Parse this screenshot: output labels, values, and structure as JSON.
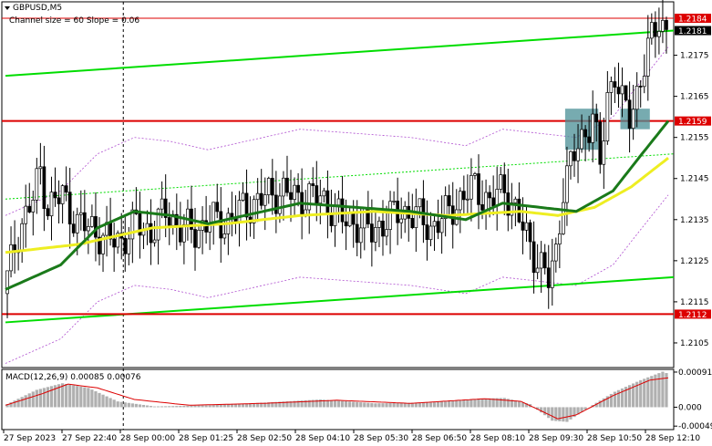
{
  "window": {
    "symbol_title": "GBPUSD,M5",
    "channel_info": "Channel size = 60 Slope = 0.06",
    "menu_arrow": "triangle-down"
  },
  "colors": {
    "background": "#ffffff",
    "frame": "#000000",
    "bull_candle": "#ffffff",
    "bear_candle": "#000000",
    "channel_line": "#00dd00",
    "channel_mid": "#00dd00",
    "ma_fast": "#1a7a1a",
    "ma_slow": "#eeee22",
    "envelope": "#b050d0",
    "level": "#dd0000",
    "highlight_box": "#4a8f96",
    "macd_hist": "#b0b0b0",
    "macd_signal": "#dd0000",
    "price_tag": "#dd0000",
    "current_tag": "#000000"
  },
  "chart_data": {
    "type": "candlestick",
    "symbol": "GBPUSD",
    "timeframe": "M5",
    "y_axis": {
      "ticks": [
        "1.2175",
        "1.2165",
        "1.2155",
        "1.2145",
        "1.2135",
        "1.2125",
        "1.2115",
        "1.2105"
      ],
      "ylim": [
        1.2099,
        1.2188
      ]
    },
    "x_axis": {
      "ticks": [
        "27 Sep 2023",
        "27 Sep 22:40",
        "28 Sep 00:00",
        "28 Sep 01:25",
        "28 Sep 02:50",
        "28 Sep 04:10",
        "28 Sep 05:30",
        "28 Sep 06:50",
        "28 Sep 08:10",
        "28 Sep 09:30",
        "28 Sep 10:50",
        "28 Sep 12:10"
      ],
      "bars": 180
    },
    "price_tags": [
      {
        "label": "1.2184",
        "value": 1.2184,
        "style": "level"
      },
      {
        "label": "1.2181",
        "value": 1.2181,
        "style": "current"
      },
      {
        "label": "1.2159",
        "value": 1.2159,
        "style": "level"
      },
      {
        "label": "1.2112",
        "value": 1.2112,
        "style": "level"
      }
    ],
    "horizontal_levels": [
      1.2184,
      1.2159,
      1.2112
    ],
    "vertical_marker_bar": 32,
    "channel": {
      "upper": [
        [
          0,
          1.217
        ],
        [
          180,
          1.2181
        ]
      ],
      "lower": [
        [
          0,
          1.211
        ],
        [
          180,
          1.2121
        ]
      ],
      "middle": [
        [
          0,
          1.214
        ],
        [
          180,
          1.2151
        ]
      ]
    },
    "highlight_boxes": [
      {
        "from_bar": 152,
        "to_bar": 161,
        "top": 1.2162,
        "bottom": 1.2152
      },
      {
        "from_bar": 167,
        "to_bar": 175,
        "top": 1.2162,
        "bottom": 1.2157
      }
    ],
    "price_path": [
      [
        0,
        1.2117
      ],
      [
        4,
        1.2132
      ],
      [
        8,
        1.214
      ],
      [
        10,
        1.2147
      ],
      [
        12,
        1.2138
      ],
      [
        16,
        1.2141
      ],
      [
        20,
        1.2134
      ],
      [
        24,
        1.2133
      ],
      [
        28,
        1.213
      ],
      [
        32,
        1.213
      ],
      [
        36,
        1.2134
      ],
      [
        40,
        1.2132
      ],
      [
        44,
        1.2137
      ],
      [
        48,
        1.2133
      ],
      [
        52,
        1.2132
      ],
      [
        56,
        1.2135
      ],
      [
        60,
        1.2134
      ],
      [
        64,
        1.2137
      ],
      [
        68,
        1.2139
      ],
      [
        72,
        1.2141
      ],
      [
        76,
        1.2142
      ],
      [
        80,
        1.214
      ],
      [
        84,
        1.2141
      ],
      [
        88,
        1.2139
      ],
      [
        92,
        1.2135
      ],
      [
        96,
        1.2134
      ],
      [
        100,
        1.2132
      ],
      [
        104,
        1.2135
      ],
      [
        108,
        1.2137
      ],
      [
        112,
        1.2136
      ],
      [
        116,
        1.2133
      ],
      [
        120,
        1.2136
      ],
      [
        124,
        1.214
      ],
      [
        128,
        1.2143
      ],
      [
        132,
        1.2139
      ],
      [
        136,
        1.2143
      ],
      [
        140,
        1.2135
      ],
      [
        144,
        1.2127
      ],
      [
        148,
        1.212
      ],
      [
        150,
        1.2127
      ],
      [
        152,
        1.2143
      ],
      [
        156,
        1.2153
      ],
      [
        160,
        1.216
      ],
      [
        162,
        1.2148
      ],
      [
        164,
        1.2165
      ],
      [
        166,
        1.2171
      ],
      [
        168,
        1.2163
      ],
      [
        170,
        1.216
      ],
      [
        172,
        1.2166
      ],
      [
        175,
        1.2176
      ],
      [
        178,
        1.2184
      ],
      [
        180,
        1.2181
      ]
    ],
    "ma_slow": [
      [
        0,
        1.2127
      ],
      [
        20,
        1.2129
      ],
      [
        40,
        1.2133
      ],
      [
        60,
        1.2134
      ],
      [
        80,
        1.2136
      ],
      [
        100,
        1.2137
      ],
      [
        120,
        1.2136
      ],
      [
        140,
        1.2137
      ],
      [
        150,
        1.2136
      ],
      [
        160,
        1.2138
      ],
      [
        170,
        1.2143
      ],
      [
        180,
        1.215
      ]
    ],
    "ma_fast": [
      [
        0,
        1.2118
      ],
      [
        15,
        1.2124
      ],
      [
        25,
        1.2133
      ],
      [
        35,
        1.2137
      ],
      [
        45,
        1.2136
      ],
      [
        55,
        1.2134
      ],
      [
        65,
        1.2136
      ],
      [
        80,
        1.2139
      ],
      [
        95,
        1.2138
      ],
      [
        110,
        1.2137
      ],
      [
        125,
        1.2135
      ],
      [
        135,
        1.2139
      ],
      [
        145,
        1.2138
      ],
      [
        155,
        1.2137
      ],
      [
        165,
        1.2142
      ],
      [
        172,
        1.215
      ],
      [
        180,
        1.2159
      ]
    ],
    "macd": {
      "label": "MACD(12,26,9) 0.00085 0.00076",
      "ticks": [
        "0.00091",
        "0.000",
        "-0.00049"
      ],
      "ylim": [
        -0.00058,
        0.00098
      ],
      "hist_path": [
        [
          0,
          8e-05
        ],
        [
          8,
          0.00045
        ],
        [
          15,
          0.00062
        ],
        [
          22,
          0.0005
        ],
        [
          30,
          0.00015
        ],
        [
          40,
          2e-05
        ],
        [
          55,
          5e-05
        ],
        [
          70,
          0.00012
        ],
        [
          85,
          0.0002
        ],
        [
          100,
          0.0001
        ],
        [
          115,
          0.00012
        ],
        [
          128,
          0.00022
        ],
        [
          135,
          0.00024
        ],
        [
          142,
          8e-05
        ],
        [
          148,
          -0.00035
        ],
        [
          152,
          -0.00038
        ],
        [
          158,
          0.0
        ],
        [
          165,
          0.0004
        ],
        [
          172,
          0.0007
        ],
        [
          178,
          0.00092
        ],
        [
          180,
          0.00085
        ]
      ],
      "signal_path": [
        [
          0,
          5e-05
        ],
        [
          10,
          0.00035
        ],
        [
          17,
          0.0006
        ],
        [
          25,
          0.0005
        ],
        [
          35,
          0.0002
        ],
        [
          50,
          5e-05
        ],
        [
          70,
          0.0001
        ],
        [
          90,
          0.00018
        ],
        [
          110,
          0.0001
        ],
        [
          130,
          0.00022
        ],
        [
          140,
          0.00015
        ],
        [
          150,
          -0.0003
        ],
        [
          155,
          -0.0002
        ],
        [
          165,
          0.0003
        ],
        [
          175,
          0.0007
        ],
        [
          180,
          0.00076
        ]
      ]
    }
  }
}
